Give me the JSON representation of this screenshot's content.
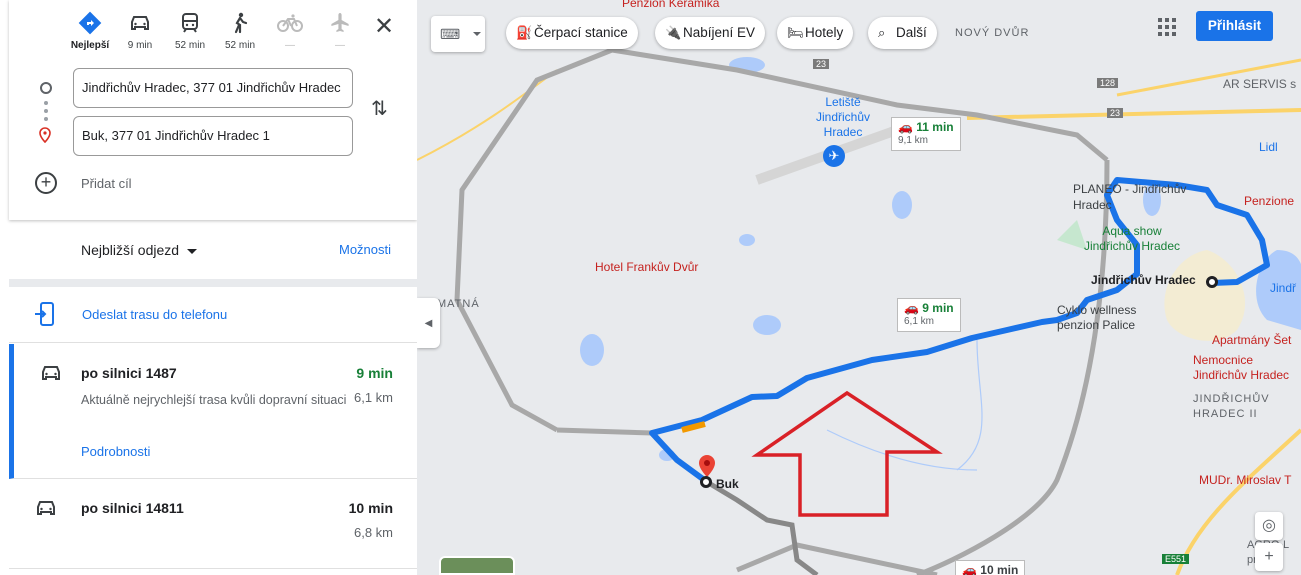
{
  "modes": [
    {
      "label": "Nejlepší",
      "icon": "directions-icon"
    },
    {
      "label": "9 min",
      "icon": "car-icon"
    },
    {
      "label": "52 min",
      "icon": "transit-icon"
    },
    {
      "label": "52 min",
      "icon": "walk-icon"
    },
    {
      "label": "—",
      "icon": "bike-icon"
    },
    {
      "label": "—",
      "icon": "flight-icon"
    }
  ],
  "origin": "Jindřichův Hradec, 377 01 Jindřichův Hradec",
  "destination": "Buk, 377 01 Jindřichův Hradec 1",
  "add_destination": "Přidat cíl",
  "depart_label": "Nejbližší odjezd",
  "options_label": "Možnosti",
  "send_label": "Odeslat trasu do telefonu",
  "routes": [
    {
      "title": "po silnici 1487",
      "time": "9 min",
      "distance": "6,1 km",
      "description": "Aktuálně nejrychlejší trasa kvůli dopravní situaci",
      "details": "Podrobnosti"
    },
    {
      "title": "po silnici 14811",
      "time": "10 min",
      "distance": "6,8 km"
    }
  ],
  "map": {
    "chips": [
      {
        "label": "Čerpací stanice",
        "icon": "gas-station-icon"
      },
      {
        "label": "Nabíjení EV",
        "icon": "ev-charging-icon"
      },
      {
        "label": "Hotely",
        "icon": "hotel-icon"
      },
      {
        "label": "Další",
        "icon": "search-icon"
      }
    ],
    "login": "Přihlásit",
    "tags": [
      {
        "time": "11 min",
        "dist": "9,1 km"
      },
      {
        "time": "9 min",
        "dist": "6,1 km"
      },
      {
        "time": "10 min"
      }
    ],
    "labels": {
      "penzion_keramika": "Penzion Keramika",
      "novy_dvur": "NOVÝ DVŮR",
      "letiste": "Letiště Jindřichův Hradec",
      "ar_servis": "AR SERVIS s",
      "lidl": "Lidl",
      "planeo": "PLANEO - Jindřichův Hradec",
      "penzione": "Penzione",
      "aqua": "Aqua show Jindřichův Hradec",
      "jh": "Jindřichův Hradec",
      "jh_right": "Jindř",
      "frankuv": "Hotel Frankův Dvůr",
      "cyklo": "Cyklo wellness penzion Palice",
      "apartmany": "Apartmány Šet",
      "nemocnice": "Nemocnice Jindřichův Hradec",
      "jh_caps": "JINDŘICHŮV HRADEC II",
      "mudr": "MUDr. Miroslav T",
      "matna": "MATNÁ",
      "buk": "Buk",
      "road_23": "23",
      "road_128": "128",
      "road_e551": "E551",
      "agro": "AGRO-L prod"
    },
    "colors": {
      "route": "#1a73e8",
      "alt": "#a8a8a8",
      "hotel": "#e8416d",
      "arrow": "#d92127",
      "traffic": "#f29900",
      "time_green": "#188038"
    }
  }
}
